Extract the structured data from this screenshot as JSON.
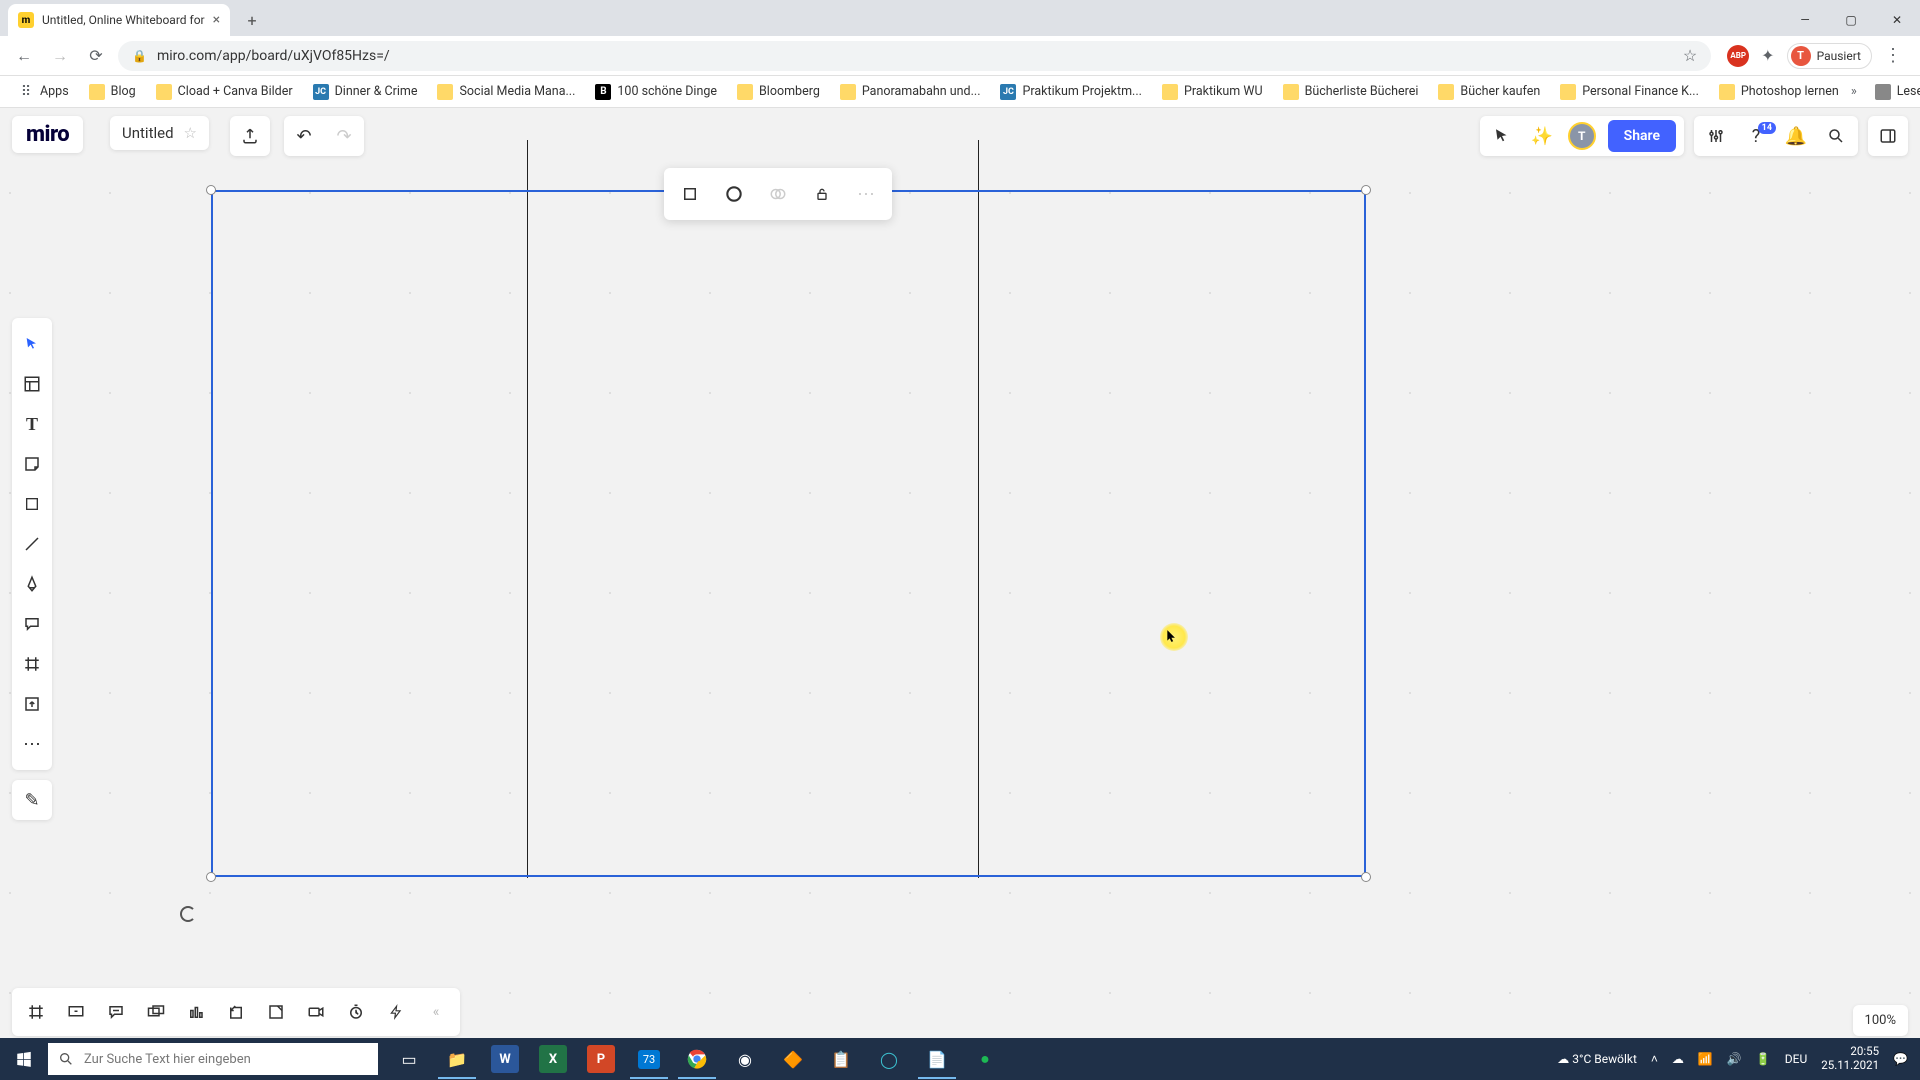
{
  "browser": {
    "tab_title": "Untitled, Online Whiteboard for",
    "url": "miro.com/app/board/uXjVOf85Hzs=/",
    "profile_label": "Pausiert",
    "profile_initial": "T",
    "bookmarks": [
      {
        "label": "Apps",
        "kind": "apps"
      },
      {
        "label": "Blog",
        "kind": "folder"
      },
      {
        "label": "Cload + Canva Bilder",
        "kind": "folder"
      },
      {
        "label": "Dinner & Crime",
        "kind": "jc"
      },
      {
        "label": "Social Media Mana...",
        "kind": "folder"
      },
      {
        "label": "100 schöne Dinge",
        "kind": "b"
      },
      {
        "label": "Bloomberg",
        "kind": "folder"
      },
      {
        "label": "Panoramabahn und...",
        "kind": "folder"
      },
      {
        "label": "Praktikum Projektm...",
        "kind": "jc"
      },
      {
        "label": "Praktikum WU",
        "kind": "folder"
      },
      {
        "label": "Bücherliste Bücherei",
        "kind": "folder"
      },
      {
        "label": "Bücher kaufen",
        "kind": "folder"
      },
      {
        "label": "Personal Finance K...",
        "kind": "folder"
      },
      {
        "label": "Photoshop lernen",
        "kind": "folder"
      }
    ],
    "reading_list": "Leseliste"
  },
  "miro": {
    "logo": "miro",
    "board_title": "Untitled",
    "share": "Share",
    "notification_count": "14",
    "avatar_initial": "T",
    "zoom": "100%"
  },
  "taskbar": {
    "search_placeholder": "Zur Suche Text hier eingeben",
    "weather_temp": "3°C",
    "weather_desc": "Bewölkt",
    "lang": "DEU",
    "time": "20:55",
    "date": "25.11.2021",
    "calendar_badge": "73"
  }
}
